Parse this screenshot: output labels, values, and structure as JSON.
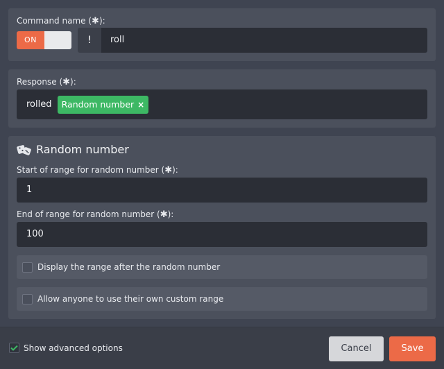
{
  "command": {
    "label": "Command name (",
    "label_end": "):",
    "required_mark": "✱",
    "toggle_label": "ON",
    "prefix": "!",
    "value": "roll"
  },
  "response": {
    "label": "Response (",
    "label_end": "):",
    "required_mark": "✱",
    "text": "rolled",
    "tag_label": "Random number",
    "tag_remove": "×"
  },
  "random_number": {
    "title": "Random number",
    "start_label": "Start of range for random number (",
    "start_label_end": "):",
    "start_value": "1",
    "end_label": "End of range for random number (",
    "end_label_end": "):",
    "end_value": "100",
    "required_mark": "✱",
    "option_display_range": "Display the range after the random number",
    "option_custom_range": "Allow anyone to use their own custom range"
  },
  "footer": {
    "advanced_label": "Show advanced options",
    "cancel_label": "Cancel",
    "save_label": "Save"
  },
  "colors": {
    "accent": "#ec6a47",
    "tag_green": "#3db864",
    "panel": "#4b505c",
    "field": "#2b2e36"
  },
  "icons": {
    "title_icon": "dice-icon",
    "advanced_check": "checkmark-icon"
  }
}
